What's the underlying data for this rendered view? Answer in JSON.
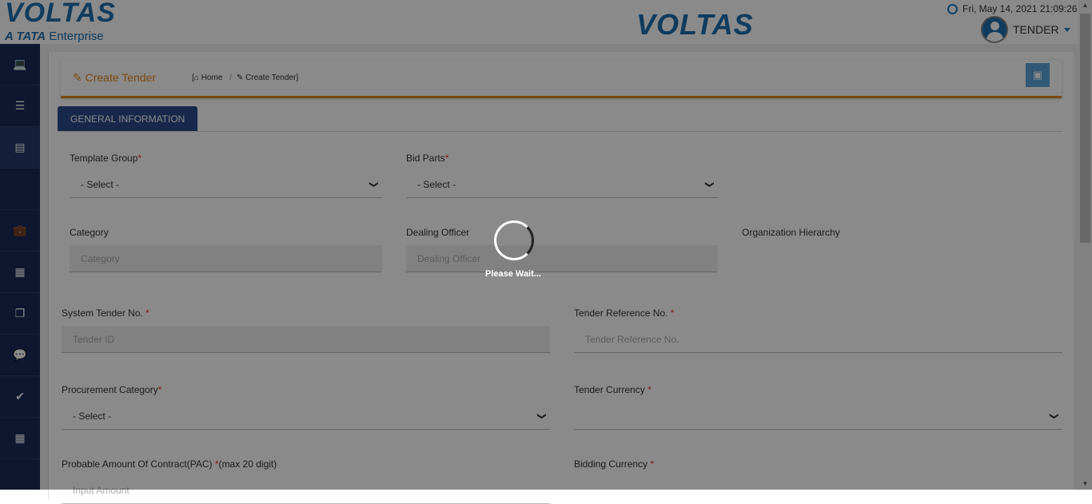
{
  "header": {
    "logo_text": "VOLTAS",
    "logo_sub_tata": "A TATA",
    "logo_sub_rest": "Enterprise",
    "center_logo": "VOLTAS",
    "datetime": "Fri, May 14, 2021 21:09:26",
    "user": "TENDER"
  },
  "sidebar": {
    "items": [
      {
        "icon": "laptop-icon",
        "glyph": "💻"
      },
      {
        "icon": "list-icon",
        "glyph": "☰"
      },
      {
        "icon": "server-icon",
        "glyph": "▤"
      },
      {
        "icon": "briefcase-icon",
        "glyph": "💼"
      },
      {
        "icon": "calculator-icon",
        "glyph": "▦"
      },
      {
        "icon": "copy-icon",
        "glyph": "❐"
      },
      {
        "icon": "comments-icon",
        "glyph": "💬"
      },
      {
        "icon": "check-circle-icon",
        "glyph": "✔"
      },
      {
        "icon": "table-icon",
        "glyph": "▦"
      }
    ]
  },
  "page": {
    "title": "Create Tender",
    "breadcrumb_home": "Home",
    "breadcrumb_sep": "/",
    "breadcrumb_current": "Create Tender]",
    "breadcrumb_open": "[",
    "tab": "GENERAL INFORMATION"
  },
  "form": {
    "template_group": {
      "label": "Template Group",
      "value": "- Select -"
    },
    "bid_parts": {
      "label": "Bid Parts",
      "value": "- Select -"
    },
    "category": {
      "label": "Category",
      "placeholder": "Category"
    },
    "dealing_officer": {
      "label": "Dealing Officer",
      "placeholder": "Dealing Officer"
    },
    "org_hierarchy": {
      "label": "Organization Hierarchy"
    },
    "system_tender_no": {
      "label": "System Tender No.",
      "placeholder": "Tender ID"
    },
    "tender_ref_no": {
      "label": "Tender Reference No.",
      "placeholder": "Tender Reference No."
    },
    "procurement_category": {
      "label": "Procurement Category",
      "value": "- Select -"
    },
    "tender_currency": {
      "label": "Tender Currency",
      "value": ""
    },
    "pac": {
      "label": "Probable Amount Of Contract(PAC)",
      "suffix": "(max 20 digit)",
      "placeholder": "Input Amount"
    },
    "bidding_currency": {
      "label": "Bidding Currency"
    }
  },
  "loader": {
    "text": "Please Wait..."
  },
  "colors": {
    "accent": "#e08a1e",
    "brand": "#1f6fae",
    "sidebar": "#1b2a5a",
    "tab": "#2c4a8a"
  }
}
